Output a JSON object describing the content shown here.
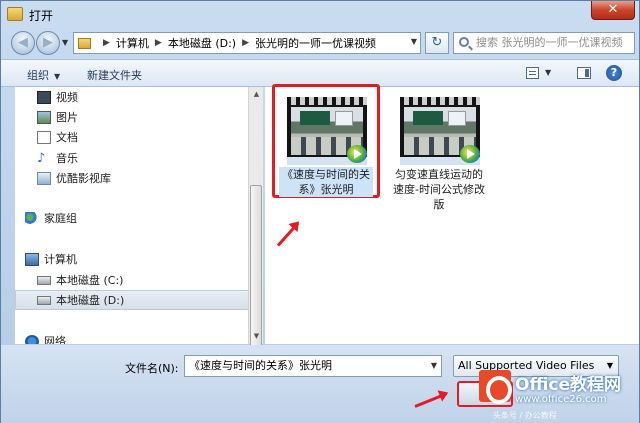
{
  "window": {
    "title": "打开",
    "close_label": "✕"
  },
  "address": {
    "breadcrumbs": [
      "计算机",
      "本地磁盘 (D:)",
      "张光明的一师一优课视频"
    ],
    "search_placeholder": "搜索 张光明的一师一优课视频",
    "back_glyph": "◀",
    "forward_glyph": "▶",
    "refresh_glyph": "↻"
  },
  "toolbar": {
    "organize_label": "组织",
    "new_folder_label": "新建文件夹"
  },
  "nav": {
    "items": [
      {
        "label": "视频",
        "icon": "video-library-icon"
      },
      {
        "label": "图片",
        "icon": "picture-library-icon"
      },
      {
        "label": "文档",
        "icon": "document-library-icon"
      },
      {
        "label": "音乐",
        "icon": "music-library-icon"
      },
      {
        "label": "优酷影视库",
        "icon": "library-icon"
      },
      {
        "label": "家庭组",
        "icon": "homegroup-icon"
      },
      {
        "label": "计算机",
        "icon": "computer-icon"
      },
      {
        "label": "本地磁盘 (C:)",
        "icon": "disk-icon"
      },
      {
        "label": "本地磁盘 (D:)",
        "icon": "disk-icon",
        "selected": true
      },
      {
        "label": "网络",
        "icon": "network-icon"
      }
    ]
  },
  "files": [
    {
      "name": "《速度与时间的关系》张光明",
      "selected": true,
      "thumbnail": "video-thumbnail-icon"
    },
    {
      "name": "匀变速直线运动的速度-时间公式修改版",
      "selected": false,
      "thumbnail": "video-thumbnail-icon"
    }
  ],
  "bottom": {
    "filename_label": "文件名(N):",
    "filename_value": "《速度与时间的关系》张光明",
    "filetype_value": "All Supported Video Files",
    "open_button_label": "打"
  },
  "watermark": {
    "name": "Office教程网",
    "url": "www.office26.com",
    "caption": "头条号 / 办公教程"
  },
  "colors": {
    "annotation_red": "#e51b24",
    "selection_blue": "#cce3f8"
  }
}
